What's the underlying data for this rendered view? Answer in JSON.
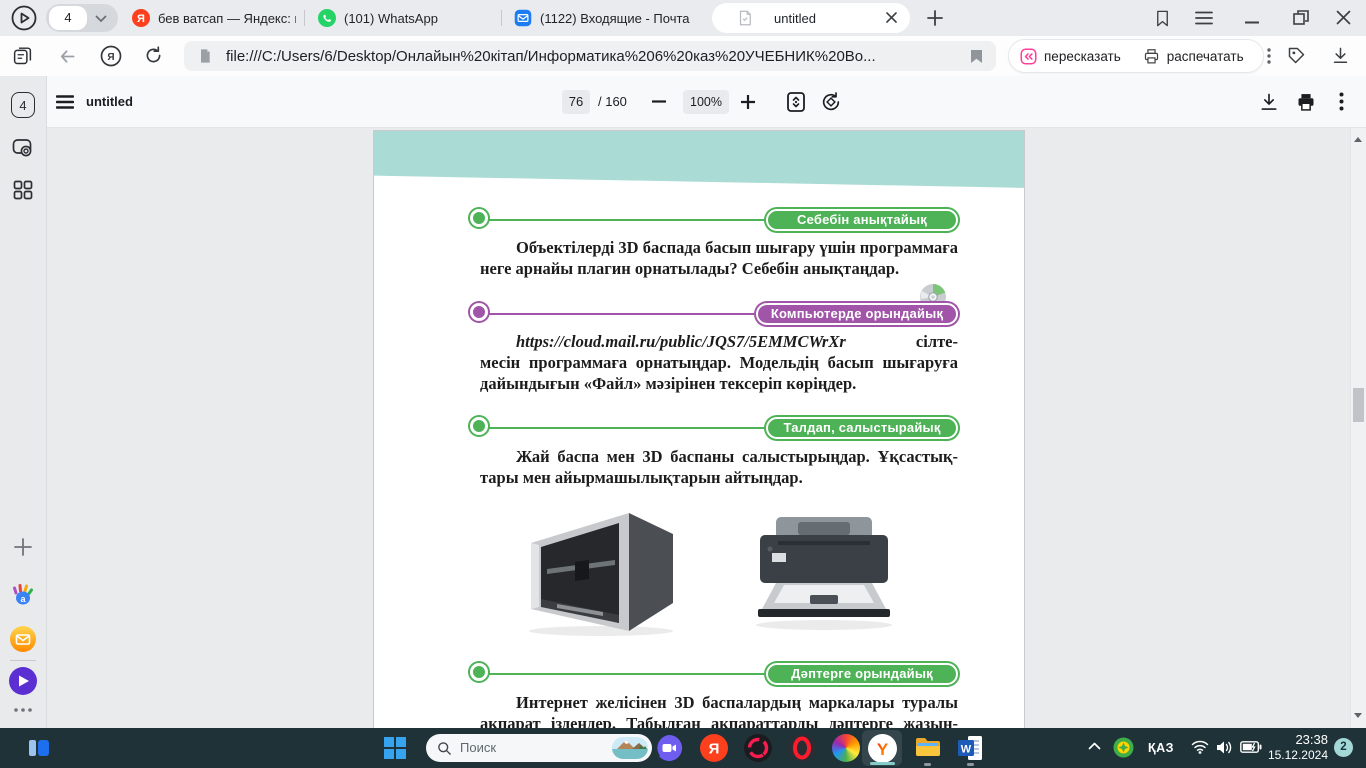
{
  "browser": {
    "tab_counter": "4",
    "tabs": [
      {
        "title": "бев ватсап — Яндекс: наш",
        "icon": "yandex-icon"
      },
      {
        "title": "(101) WhatsApp",
        "icon": "whatsapp-icon"
      },
      {
        "title": "(1122) Входящие - Почта",
        "icon": "mail-icon"
      },
      {
        "title": "untitled",
        "icon": "pdf-icon",
        "active": true
      }
    ],
    "address": {
      "url": "file:///C:/Users/6/Desktop/Онлайын%20кітап/Информатика%206%20каз%20УЧЕБНИК%20Во...",
      "retell": "пересказать",
      "print": "распечатать"
    }
  },
  "pdf": {
    "title": "untitled",
    "page": "76",
    "page_total": "/ 160",
    "zoom": "100%",
    "sidebar_tab_count": "4"
  },
  "doc": {
    "sections": [
      {
        "badge": "Себебін анықтайық",
        "accent": "#4eb257",
        "lines": [
          "Объектілерді 3D баспада басып шығару үшін программаға",
          "неге арнайы плагин орнатылады? Себебін анықтаңдар."
        ]
      },
      {
        "badge": "Компьютерде орындайық",
        "accent": "#a155a8",
        "url": "https://cloud.mail.ru/public/JQS7/5EMMCWrXr",
        "lines": [
          "сілте-",
          "месін программаға орнатыңдар. Модельдің басып шығаруға",
          "дайындығын «Файл» мәзірінен тексеріп көріңдер."
        ]
      },
      {
        "badge": "Талдап, салыстырайық",
        "accent": "#4eb257",
        "lines": [
          "Жай баспа мен 3D баспаны салыстырыңдар. Ұқсастық-",
          "тары мен айырмашылықтарын айтыңдар."
        ]
      },
      {
        "badge": "Дәптерге орындайық",
        "accent": "#4eb257",
        "lines": [
          "Интернет желісінен 3D баспалардың маркалары туралы",
          "ақпарат іздеңдер. Табылған ақпараттарды дәптерге жазың-"
        ]
      }
    ],
    "images": [
      "3d-printer",
      "laser-printer"
    ]
  },
  "taskbar": {
    "search_placeholder": "Поиск",
    "language": "ҚАЗ",
    "time": "23:38",
    "date": "15.12.2024",
    "notification_count": "2"
  },
  "icons": {
    "yandex_letter": "Я",
    "word_letter": "W",
    "browser_letter": "Y"
  },
  "colors": {
    "badge_green": "#4eb257",
    "badge_purple": "#a155a8",
    "page_band_teal": "#aadbd5",
    "taskbar_bg": "#1e3237",
    "active_app_underline": "#86ccc8",
    "whatsapp_green": "#25d366",
    "yandex_red": "#fc3f1d",
    "mail_blue": "#1c7df2"
  }
}
